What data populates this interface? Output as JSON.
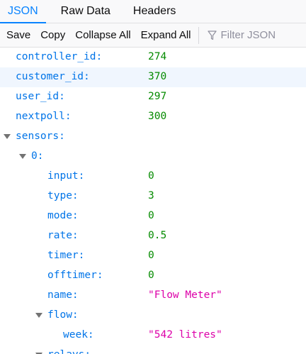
{
  "tabs": [
    {
      "label": "JSON",
      "active": true
    },
    {
      "label": "Raw Data",
      "active": false
    },
    {
      "label": "Headers",
      "active": false
    }
  ],
  "toolbar": {
    "save": "Save",
    "copy": "Copy",
    "collapse_all": "Collapse All",
    "expand_all": "Expand All",
    "filter_placeholder": "Filter JSON"
  },
  "tree": {
    "controller_id": {
      "key": "controller_id:",
      "value": "274"
    },
    "customer_id": {
      "key": "customer_id:",
      "value": "370"
    },
    "user_id": {
      "key": "user_id:",
      "value": "297"
    },
    "nextpoll": {
      "key": "nextpoll:",
      "value": "300"
    },
    "sensors": {
      "key": "sensors:"
    },
    "sensor0": {
      "key": "0:"
    },
    "input": {
      "key": "input:",
      "value": "0"
    },
    "type": {
      "key": "type:",
      "value": "3"
    },
    "mode": {
      "key": "mode:",
      "value": "0"
    },
    "rate": {
      "key": "rate:",
      "value": "0.5"
    },
    "timer": {
      "key": "timer:",
      "value": "0"
    },
    "offtimer": {
      "key": "offtimer:",
      "value": "0"
    },
    "name": {
      "key": "name:",
      "value": "\"Flow Meter\""
    },
    "flow": {
      "key": "flow:"
    },
    "week": {
      "key": "week:",
      "value": "\"542 litres\""
    },
    "relays": {
      "key": "relays:"
    }
  },
  "colors": {
    "accent": "#0a84ff",
    "key": "#0074e8",
    "number": "#058b00",
    "string": "#dd00a9",
    "selected_row": "#f0f6fe"
  }
}
